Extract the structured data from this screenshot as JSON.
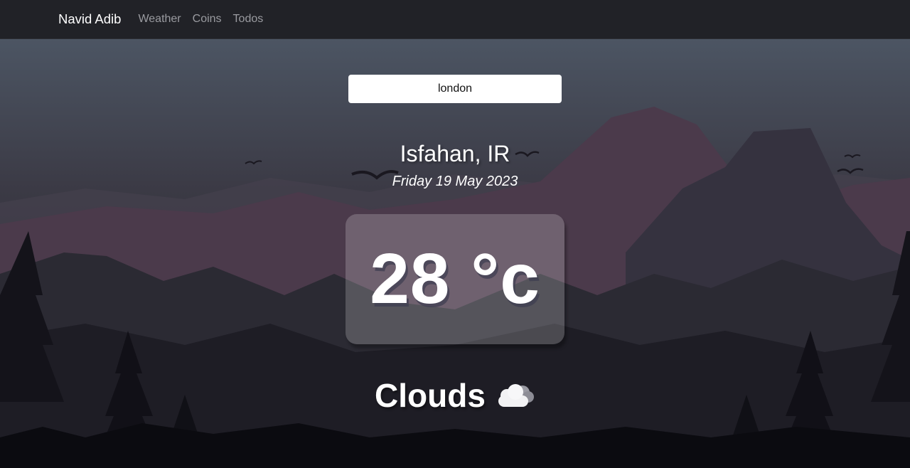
{
  "nav": {
    "brand": "Navid Adib",
    "links": [
      "Weather",
      "Coins",
      "Todos"
    ]
  },
  "search": {
    "value": "london",
    "placeholder": ""
  },
  "weather": {
    "location": "Isfahan, IR",
    "date": "Friday 19 May 2023",
    "temperature": "28 °c",
    "condition": "Clouds",
    "condition_icon": "cloud-icon"
  },
  "colors": {
    "navbar_bg": "#212227",
    "sky_top": "#4a5260",
    "mountain": "#4a3a4a",
    "text": "#ffffff"
  }
}
